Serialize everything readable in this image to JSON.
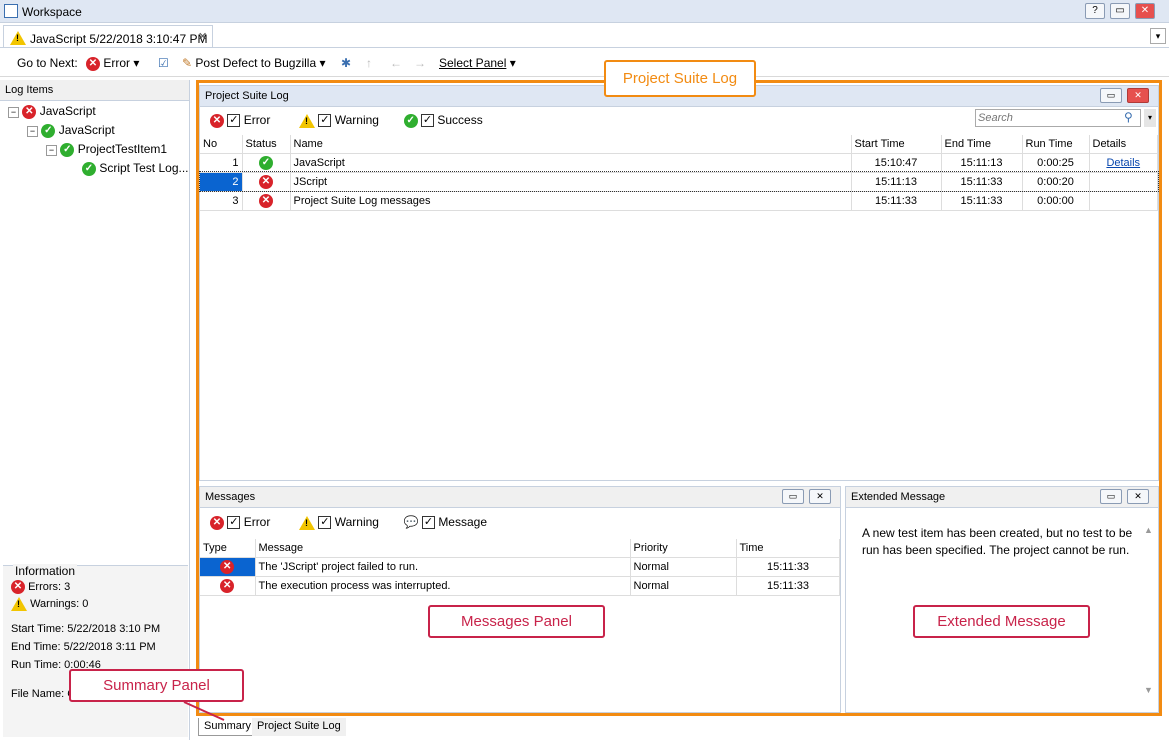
{
  "window": {
    "title": "Workspace"
  },
  "doc_tab": {
    "label": "JavaScript 5/22/2018 3:10:47 PM"
  },
  "toolbar": {
    "go_to_next": "Go to Next:",
    "error": "Error",
    "post_defect": "Post Defect to Bugzilla",
    "select_panel": "Select Panel"
  },
  "sidebar": {
    "header": "Log Items",
    "tree": [
      {
        "label": "JavaScript",
        "status": "error"
      },
      {
        "label": "JavaScript",
        "status": "ok"
      },
      {
        "label": "ProjectTestItem1",
        "status": "ok"
      },
      {
        "label": "Script Test Log...",
        "status": "ok"
      }
    ]
  },
  "info": {
    "header": "Information",
    "errors": "Errors: 3",
    "warnings": "Warnings: 0",
    "start_time": "Start Time: 5/22/2018 3:10 PM",
    "end_time": "End Time: 5/22/2018 3:11 PM",
    "run_time": "Run Time: 0:00:46",
    "file_name": "File Name: C"
  },
  "suite_log": {
    "title": "Project Suite Log",
    "filters": {
      "error": "Error",
      "warning": "Warning",
      "success": "Success"
    },
    "search_placeholder": "Search",
    "columns": [
      "No",
      "Status",
      "Name",
      "Start Time",
      "End Time",
      "Run Time",
      "Details"
    ],
    "rows": [
      {
        "no": "1",
        "status": "ok",
        "name": "JavaScript",
        "start": "15:10:47",
        "end": "15:11:13",
        "run": "0:00:25",
        "details": "Details"
      },
      {
        "no": "2",
        "status": "error",
        "name": "JScript",
        "start": "15:11:13",
        "end": "15:11:33",
        "run": "0:00:20",
        "details": ""
      },
      {
        "no": "3",
        "status": "error",
        "name": "Project Suite Log messages",
        "start": "15:11:33",
        "end": "15:11:33",
        "run": "0:00:00",
        "details": ""
      }
    ]
  },
  "messages": {
    "title": "Messages",
    "filters": {
      "error": "Error",
      "warning": "Warning",
      "message": "Message"
    },
    "columns": [
      "Type",
      "Message",
      "Priority",
      "Time"
    ],
    "rows": [
      {
        "message": "The 'JScript' project failed to run.",
        "priority": "Normal",
        "time": "15:11:33"
      },
      {
        "message": "The execution process was interrupted.",
        "priority": "Normal",
        "time": "15:11:33"
      }
    ]
  },
  "extended": {
    "title": "Extended Message",
    "text": "A new test item has been created, but no test to be run has been specified. The project cannot be run."
  },
  "bottom_tabs": {
    "summary": "Summary",
    "suite_log": "Project Suite Log"
  },
  "callouts": {
    "suite_log": "Project Suite Log",
    "messages_panel": "Messages Panel",
    "extended": "Extended Message",
    "summary_panel": "Summary Panel"
  },
  "colors": {
    "accent_orange": "#f28b12",
    "callout_red": "#c8234a",
    "error": "#d8232a",
    "success": "#2fae2f"
  }
}
